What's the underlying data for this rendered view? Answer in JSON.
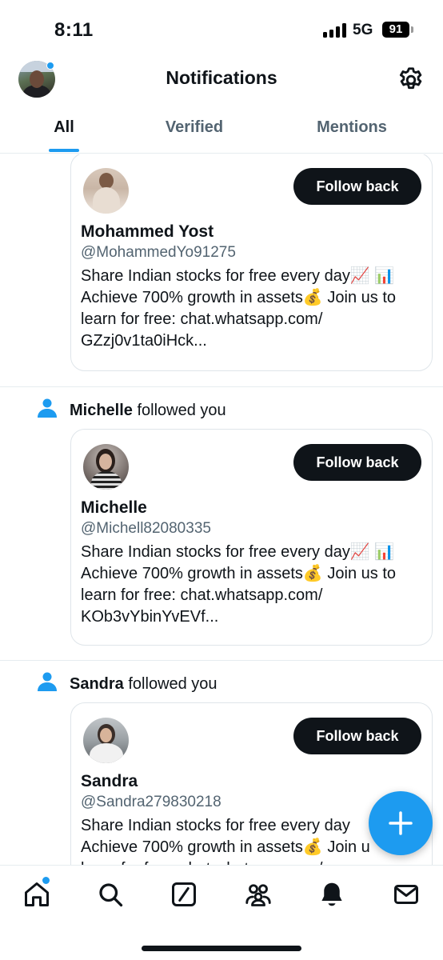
{
  "status_bar": {
    "time": "8:11",
    "network": "5G",
    "battery": "91"
  },
  "header": {
    "title": "Notifications"
  },
  "tabs": [
    {
      "label": "All",
      "active": true
    },
    {
      "label": "Verified",
      "active": false
    },
    {
      "label": "Mentions",
      "active": false
    }
  ],
  "notifications": [
    {
      "follower_name": "",
      "action_text": "",
      "card": {
        "name": "Mohammed Yost",
        "handle": "@MohammedYo91275",
        "bio_lines": [
          "Share Indian stocks for free every day📈 📊",
          "Achieve 700% growth in assets💰 Join us to",
          "learn for free: chat.whatsapp.com/",
          "GZzj0v1ta0iHck..."
        ],
        "button_label": "Follow back"
      }
    },
    {
      "follower_name": "Michelle",
      "action_text": "followed you",
      "card": {
        "name": "Michelle",
        "handle": "@Michell82080335",
        "bio_lines": [
          "Share Indian stocks for free every day📈 📊",
          "Achieve 700% growth in assets💰 Join us to",
          "learn for free: chat.whatsapp.com/",
          "KOb3vYbinYvEVf..."
        ],
        "button_label": "Follow back"
      }
    },
    {
      "follower_name": "Sandra",
      "action_text": "followed you",
      "card": {
        "name": "Sandra",
        "handle": "@Sandra279830218",
        "bio_lines": [
          "Share Indian stocks for free every day",
          "Achieve 700% growth in assets💰 Join u",
          "learn for free: chat.whatsapp.com/"
        ],
        "button_label": "Follow back"
      }
    }
  ],
  "colors": {
    "accent": "#1d9bf0",
    "text_primary": "#0f1419",
    "text_secondary": "#536471",
    "button_bg": "#0f1419"
  },
  "icons": {
    "settings": "gear-icon",
    "compose": "plus-icon",
    "nav": [
      "home-icon",
      "search-icon",
      "grok-icon",
      "communities-icon",
      "bell-icon",
      "mail-icon"
    ]
  }
}
